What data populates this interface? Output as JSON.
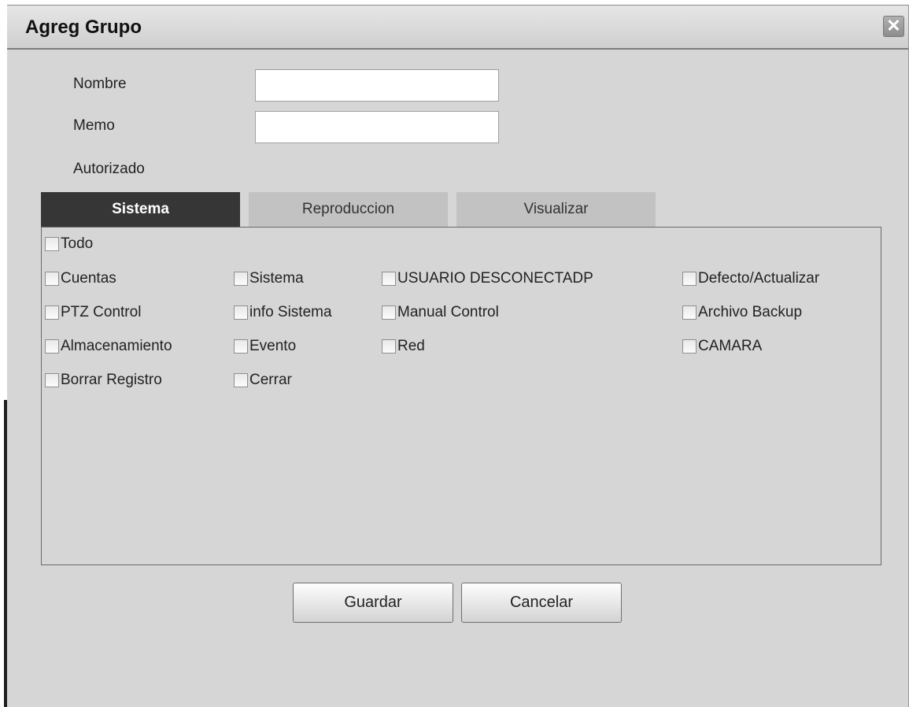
{
  "dialog": {
    "title": "Agreg Grupo",
    "close_icon": "close-icon"
  },
  "form": {
    "name_label": "Nombre",
    "name_value": "",
    "memo_label": "Memo",
    "memo_value": "",
    "authorized_label": "Autorizado"
  },
  "tabs": [
    {
      "label": "Sistema",
      "active": true
    },
    {
      "label": "Reproduccion",
      "active": false
    },
    {
      "label": "Visualizar",
      "active": false
    }
  ],
  "permissions": {
    "all": "Todo",
    "items": [
      "Cuentas",
      "Sistema",
      "USUARIO DESCONECTADP",
      "Defecto/Actualizar",
      "PTZ Control",
      "info Sistema",
      "Manual Control",
      "Archivo Backup",
      "Almacenamiento",
      "Evento",
      "Red",
      "CAMARA",
      "Borrar Registro",
      "Cerrar"
    ]
  },
  "buttons": {
    "save": "Guardar",
    "cancel": "Cancelar"
  },
  "colors": {
    "active_tab": "#363636",
    "inactive_tab": "#c2c2c2",
    "dialog_bg": "#d6d6d6"
  }
}
